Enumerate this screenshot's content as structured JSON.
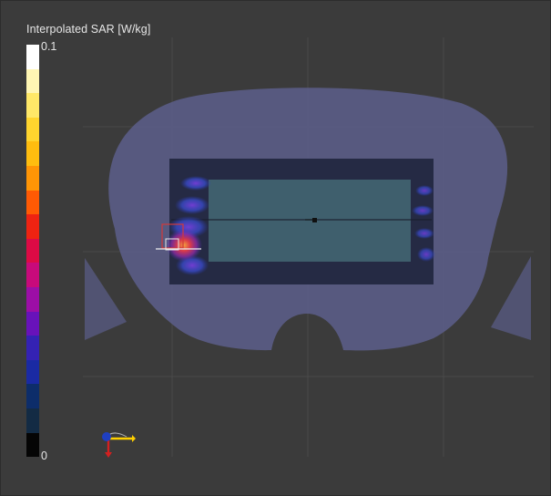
{
  "legend": {
    "title": "Interpolated SAR [W/kg]",
    "max_label": "0.1",
    "min_label": "0",
    "colors": [
      "#ffffff",
      "#fff6b4",
      "#ffe868",
      "#ffd52e",
      "#ffbd0f",
      "#ff9506",
      "#ff5a04",
      "#ee2312",
      "#dd0a45",
      "#c80a7b",
      "#9c0ea6",
      "#6812ba",
      "#3422b3",
      "#1a2aa3",
      "#0d2d6a",
      "#132b44",
      "#050505"
    ]
  },
  "scene": {
    "phantom_color": "#5a5c86",
    "plate_color": "#252a44",
    "panel_color": "#3f5f6d",
    "grid_color": "#565656"
  }
}
